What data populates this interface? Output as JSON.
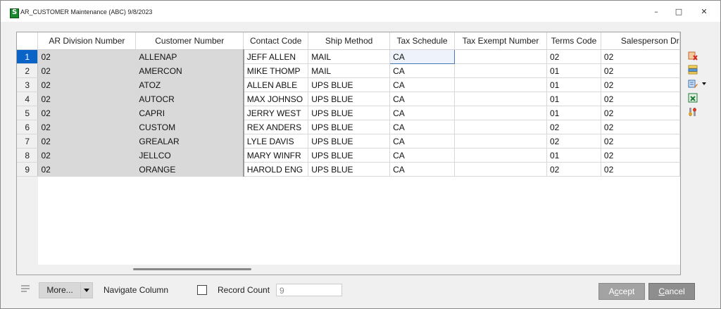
{
  "window": {
    "title": "AR_CUSTOMER Maintenance (ABC) 9/8/2023",
    "minimize": "–",
    "maximize": "□",
    "close": "✕"
  },
  "grid": {
    "columns": [
      "AR Division Number",
      "Customer Number",
      "Contact Code",
      "Ship Method",
      "Tax Schedule",
      "Tax Exempt Number",
      "Terms Code",
      "Salesperson Dr"
    ],
    "rows": [
      {
        "num": "1",
        "division": "02",
        "customer": "ALLENAP",
        "contact": "JEFF ALLEN",
        "ship": "MAIL",
        "tax": "CA",
        "exempt": "",
        "terms": "02",
        "sales": "02"
      },
      {
        "num": "2",
        "division": "02",
        "customer": "AMERCON",
        "contact": "MIKE THOMP",
        "ship": "MAIL",
        "tax": "CA",
        "exempt": "",
        "terms": "01",
        "sales": "02"
      },
      {
        "num": "3",
        "division": "02",
        "customer": "ATOZ",
        "contact": "ALLEN ABLE",
        "ship": "UPS BLUE",
        "tax": "CA",
        "exempt": "",
        "terms": "01",
        "sales": "02"
      },
      {
        "num": "4",
        "division": "02",
        "customer": "AUTOCR",
        "contact": "MAX JOHNSO",
        "ship": "UPS BLUE",
        "tax": "CA",
        "exempt": "",
        "terms": "01",
        "sales": "02"
      },
      {
        "num": "5",
        "division": "02",
        "customer": "CAPRI",
        "contact": "JERRY WEST",
        "ship": "UPS BLUE",
        "tax": "CA",
        "exempt": "",
        "terms": "01",
        "sales": "02"
      },
      {
        "num": "6",
        "division": "02",
        "customer": "CUSTOM",
        "contact": "REX ANDERS",
        "ship": "UPS BLUE",
        "tax": "CA",
        "exempt": "",
        "terms": "02",
        "sales": "02"
      },
      {
        "num": "7",
        "division": "02",
        "customer": "GREALAR",
        "contact": "LYLE DAVIS",
        "ship": "UPS BLUE",
        "tax": "CA",
        "exempt": "",
        "terms": "02",
        "sales": "02"
      },
      {
        "num": "8",
        "division": "02",
        "customer": "JELLCO",
        "contact": "MARY WINFR",
        "ship": "UPS BLUE",
        "tax": "CA",
        "exempt": "",
        "terms": "01",
        "sales": "02"
      },
      {
        "num": "9",
        "division": "02",
        "customer": "ORANGE",
        "contact": "HAROLD ENG",
        "ship": "UPS BLUE",
        "tax": "CA",
        "exempt": "",
        "terms": "02",
        "sales": "02"
      }
    ]
  },
  "side_tools": [
    "delete-row-icon",
    "customize-columns-icon",
    "edit-dropdown-icon",
    "export-excel-icon",
    "settings-tools-icon"
  ],
  "bottom": {
    "more_label": "More...",
    "navigate_label": "Navigate Column",
    "record_count_label": "Record Count",
    "record_count_value": "9",
    "accept_prefix": "A",
    "accept_underline": "c",
    "accept_suffix": "cept",
    "cancel_underline": "C",
    "cancel_suffix": "ancel"
  },
  "colors": {
    "selected_row": "#0a64c8",
    "gray_cell": "#d9d9d9",
    "accept_bg": "#a3a3a3",
    "cancel_bg": "#8e8e8e"
  }
}
